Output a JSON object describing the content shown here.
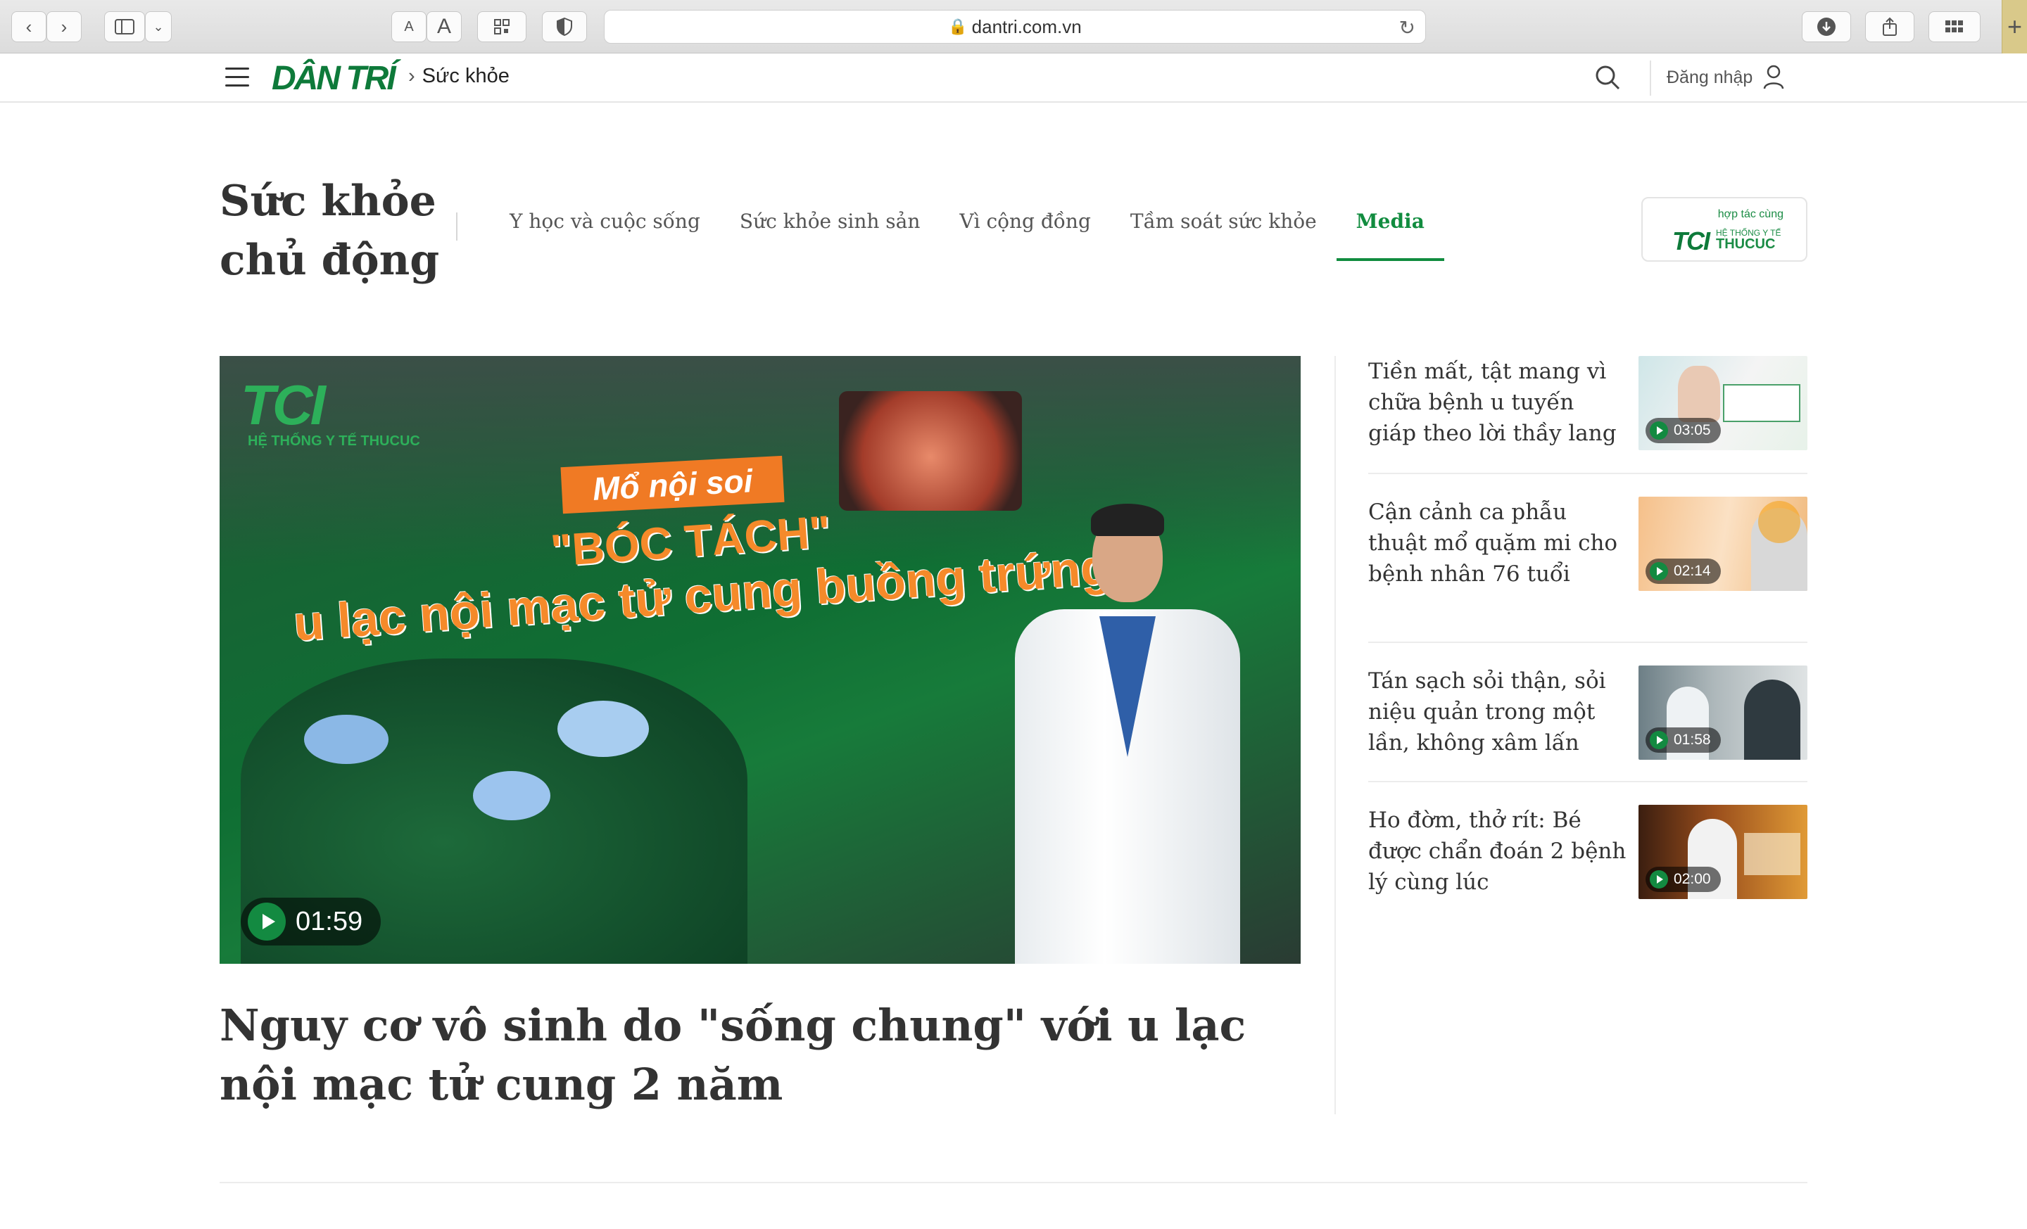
{
  "browser": {
    "url": "dantri.com.vn",
    "text_small_label": "A",
    "text_large_label": "A"
  },
  "header": {
    "logo_text": "DÂN TRÍ",
    "breadcrumb": "Sức khỏe",
    "login_label": "Đăng nhập"
  },
  "section": {
    "title": "Sức khỏe chủ động",
    "nav": [
      {
        "label": "Y học và cuộc sống",
        "active": false
      },
      {
        "label": "Sức khỏe sinh sản",
        "active": false
      },
      {
        "label": "Vì cộng đồng",
        "active": false
      },
      {
        "label": "Tầm soát sức khỏe",
        "active": false
      },
      {
        "label": "Media",
        "active": true
      }
    ],
    "partner": {
      "caption": "hợp tác cùng",
      "logo": "TCI",
      "system": "HỆ THỐNG Y TẾ",
      "brand": "THUCUC"
    }
  },
  "featured": {
    "thumb_logo": "TCI",
    "thumb_logo_sub": "HỆ THỐNG Y TẾ THUCUC",
    "thumb_pill": "Mổ nội soi",
    "thumb_line1": "\"BÓC TÁCH\"",
    "thumb_line2": "u lạc nội mạc tử cung buồng trứng",
    "duration": "01:59",
    "title": "Nguy cơ vô sinh do \"sống chung\" với u lạc nội mạc tử cung 2 năm"
  },
  "side_list": [
    {
      "title": "Tiền mất, tật mang vì chữa bệnh u tuyến giáp theo lời thầy lang",
      "duration": "03:05"
    },
    {
      "title": "Cận cảnh ca phẫu thuật mổ quặm mi cho bệnh nhân 76 tuổi",
      "duration": "02:14"
    },
    {
      "title": "Tán sạch sỏi thận, sỏi niệu quản trong một lần, không xâm lấn",
      "duration": "01:58"
    },
    {
      "title": "Ho đờm, thở rít: Bé được chẩn đoán 2 bệnh lý cùng lúc",
      "duration": "02:00"
    }
  ],
  "colors": {
    "brand_green": "#118c3f",
    "text_dark": "#333333",
    "nav_gray": "#555555"
  }
}
